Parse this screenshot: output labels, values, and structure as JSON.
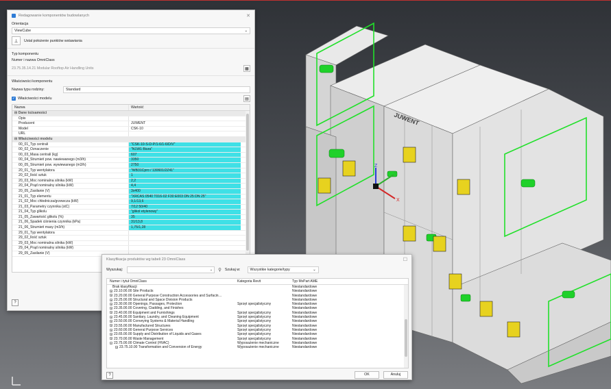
{
  "main_dialog": {
    "title": "Redagowanie komponentów budowlanych",
    "orientation_label": "Orientacja",
    "orientation_value": "ViewCube",
    "insertion_button_label": "Ustal położenie punktów wstawiania",
    "component_type_label": "Typ komponentu",
    "omniclass_label": "Numer i nazwa OmniClass",
    "omniclass_value": "23.75.35.14.21 Modular Rooftop Air Handling Units",
    "component_props_label": "Właściwości komponentu",
    "family_name_label": "Nazwa typu rodziny:",
    "family_name_value": "Standard",
    "model_props_checkbox": "Właściwości modelu",
    "table_headers": [
      "Nazwa",
      "Wartość"
    ],
    "groups": {
      "identity": "Dane tożsamości",
      "model": "Właściwości modelu"
    },
    "identity_rows": [
      {
        "name": "Opis",
        "value": ""
      },
      {
        "name": "Producent",
        "value": "JUWENT"
      },
      {
        "name": "Model",
        "value": "CSK-10"
      },
      {
        "name": "URL",
        "value": ""
      }
    ],
    "model_rows": [
      {
        "name": "00_01_Typ centrali",
        "value": "\"CSK-10-S-D-P/1-6/1-6/D/V\""
      },
      {
        "name": "00_02_Oznaczenie",
        "value": "\"N1W1 Biura\""
      },
      {
        "name": "00_03_Masa centrali (kg)",
        "value": "607"
      },
      {
        "name": "00_04_Strumień pow. nawiewanego (m3/h)",
        "value": "3350"
      },
      {
        "name": "00_05_Strumień pow. wywiewanego (m3/h)",
        "value": "2750"
      },
      {
        "name": "20_01_Typ wentylatora",
        "value": "\"WB31Cpro / 130601/2Z41\""
      },
      {
        "name": "20_02_Ilość sztuk",
        "value": "1"
      },
      {
        "name": "20_03_Moc nominalna silnika (kW)",
        "value": "2,2"
      },
      {
        "name": "20_04_Prąd nominalny silnika (kW)",
        "value": "4,4"
      },
      {
        "name": "20_05_Zasilanie (V)",
        "value": "3x400"
      },
      {
        "name": "21_01_Typ elementu",
        "value": "\"XRCAS 0540 T016-02 F30 E003 DN 25 DN 25\""
      },
      {
        "name": "21_02_Moc chłodnicza/grzewcza (kW)",
        "value": "9,1/13,6"
      },
      {
        "name": "21_03_Parametry czynnika (stC)",
        "value": "7/12 50/40"
      },
      {
        "name": "21_04_Typ glikolu",
        "value": "\"glikol etylenowy\""
      },
      {
        "name": "21_05_Zawartość glikolu (%)",
        "value": "35"
      },
      {
        "name": "21_06_Spadek ciśnienia czynnika (kPa)",
        "value": "31/13,8"
      },
      {
        "name": "21_06_Strumień masy (m3/h)",
        "value": "1,75/1,28"
      },
      {
        "name": "29_01_Typ wentylatora",
        "value": ""
      },
      {
        "name": "29_02_Ilość sztuk",
        "value": ""
      },
      {
        "name": "29_03_Moc nominalna silnika (kW)",
        "value": ""
      },
      {
        "name": "29_04_Prąd nominalny silnika (kW)",
        "value": ""
      },
      {
        "name": "29_05_Zasilanie (V)",
        "value": ""
      }
    ],
    "help_label": "?"
  },
  "class_dialog": {
    "title": "Klasyfikacja produktów wg tabeli 23 OmniClass",
    "search_label": "Wyszukaj:",
    "search_value": "",
    "scope_label": "Szukaj w:",
    "scope_value": "Wszystkie kategorie/typy",
    "headers": [
      "Numer i tytuł OmniClass",
      "Kategoria Revit",
      "Typ MvPart AME"
    ],
    "rows": [
      {
        "title": "Brak klasyfikacji",
        "cat": "",
        "type": "Niestandardowe",
        "exp": ""
      },
      {
        "title": "23.10.00.00  Site Products",
        "cat": "",
        "type": "Niestandardowe",
        "exp": "+"
      },
      {
        "title": "23.20.00.00  General Purpose Construction Accessories and Surfacin…",
        "cat": "",
        "type": "Niestandardowe",
        "exp": "+"
      },
      {
        "title": "23.25.00.00  Structural and Space Division Products",
        "cat": "",
        "type": "Niestandardowe",
        "exp": "+"
      },
      {
        "title": "23.30.00.00  Openings, Passages, Protection",
        "cat": "Sprzęt specjalistyczny",
        "type": "Niestandardowe",
        "exp": "+"
      },
      {
        "title": "23.35.00.00  Covering, Cladding, and Finishes",
        "cat": "",
        "type": "Niestandardowe",
        "exp": "+"
      },
      {
        "title": "23.40.00.00  Equipment and Furnishings",
        "cat": "Sprzęt specjalistyczny",
        "type": "Niestandardowe",
        "exp": "+"
      },
      {
        "title": "23.45.00.00  Sanitary, Laundry, and Cleaning Equipment",
        "cat": "Sprzęt specjalistyczny",
        "type": "Niestandardowe",
        "exp": "+"
      },
      {
        "title": "23.50.00.00  Conveying Systems & Material Handling",
        "cat": "Sprzęt specjalistyczny",
        "type": "Niestandardowe",
        "exp": "+"
      },
      {
        "title": "23.55.00.00  Manufactured Structures",
        "cat": "Sprzęt specjalistyczny",
        "type": "Niestandardowe",
        "exp": "+"
      },
      {
        "title": "23.60.00.00  General Purpose Services",
        "cat": "Sprzęt specjalistyczny",
        "type": "Niestandardowe",
        "exp": "+"
      },
      {
        "title": "23.65.00.00  Supply and Distribution of Liquids and Gases",
        "cat": "Sprzęt specjalistyczny",
        "type": "Niestandardowe",
        "exp": "+"
      },
      {
        "title": "23.70.00.00  Waste Management",
        "cat": "Sprzęt specjalistyczny",
        "type": "Niestandardowe",
        "exp": "+"
      },
      {
        "title": "23.75.00.00  Climate Control (HVAC)",
        "cat": "Wyposażenie mechaniczne",
        "type": "Niestandardowe",
        "exp": "−"
      },
      {
        "title": "23.75.10.00  Transformation and Conversion of Energy",
        "cat": "Wyposażenie mechaniczne",
        "type": "Niestandardowe",
        "exp": "+"
      }
    ],
    "ok_label": "OK",
    "cancel_label": "Anuluj",
    "help_label": "?"
  },
  "model_view": {
    "brand_text": "JUWENT",
    "axis_x": "X",
    "axis_y": "Y",
    "axis_z": "Z"
  }
}
